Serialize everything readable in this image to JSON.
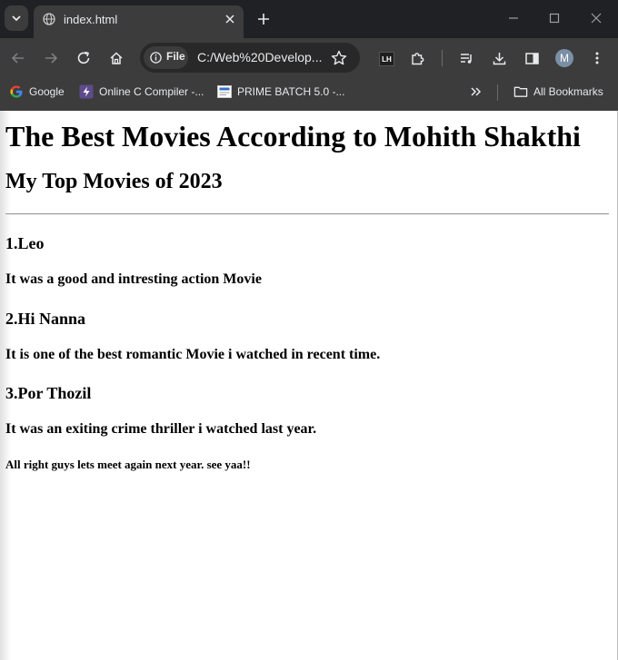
{
  "browser": {
    "tab": {
      "title": "index.html"
    },
    "omnibox": {
      "scheme_label": "File",
      "url": "C:/Web%20Develop..."
    },
    "extension_badge": "LH",
    "profile_initial": "M",
    "bookmarks": [
      {
        "label": "Google",
        "icon": "google-icon"
      },
      {
        "label": "Online C Compiler -...",
        "icon": "lightning-icon"
      },
      {
        "label": "PRIME BATCH 5.0 -...",
        "icon": "doc-thumbnail-icon"
      }
    ],
    "all_bookmarks_label": "All Bookmarks",
    "colors": {
      "frame": "#202124",
      "toolbar": "#3c3c3c",
      "omnibox": "#282828",
      "text": "#e8eaed"
    }
  },
  "page": {
    "title": "The Best Movies According to Mohith Shakthi",
    "subtitle": "My Top Movies of 2023",
    "movies": [
      {
        "heading": "1.Leo",
        "description": "It was a good and intresting action Movie"
      },
      {
        "heading": "2.Hi Nanna",
        "description": "It is one of the best romantic Movie i watched in recent time."
      },
      {
        "heading": "3.Por Thozil",
        "description": "It was an exiting crime thriller i watched last year."
      }
    ],
    "closing": "All right guys lets meet again next year. see yaa!!"
  }
}
